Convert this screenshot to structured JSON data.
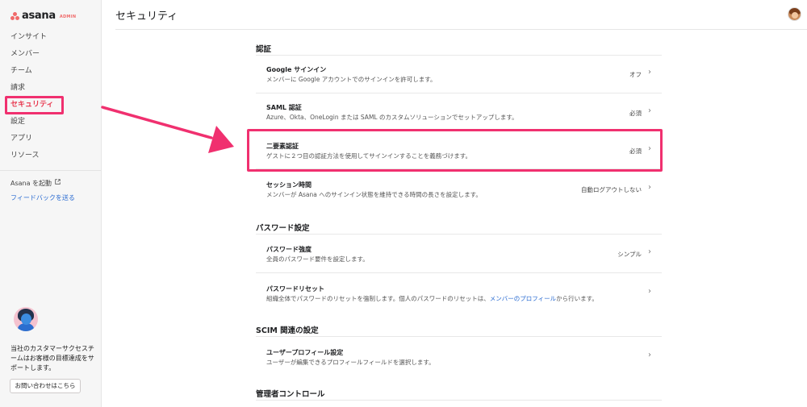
{
  "app": {
    "logo_word": "asana",
    "logo_badge": "ADMIN",
    "page_title": "セキュリティ"
  },
  "sidebar": {
    "items": [
      {
        "label": "インサイト",
        "active": false
      },
      {
        "label": "メンバー",
        "active": false
      },
      {
        "label": "チーム",
        "active": false
      },
      {
        "label": "請求",
        "active": false
      },
      {
        "label": "セキュリティ",
        "active": true
      },
      {
        "label": "設定",
        "active": false
      },
      {
        "label": "アプリ",
        "active": false
      },
      {
        "label": "リソース",
        "active": false
      }
    ],
    "launch_label": "Asana を起動",
    "feedback_label": "フィードバックを送る",
    "support_text": "当社のカスタマーサクセスチームはお客様の目標達成をサポートします。",
    "contact_button": "お問い合わせはこちら"
  },
  "sections": {
    "auth": {
      "title": "認証",
      "rows": [
        {
          "title": "Google サインイン",
          "desc": "メンバーに Google アカウントでのサインインを許可します。",
          "value": "オフ"
        },
        {
          "title": "SAML 認証",
          "desc": "Azure、Okta、OneLogin または SAML のカスタムソリューションでセットアップします。",
          "value": "必須"
        },
        {
          "title": "二要素認証",
          "desc": "ゲストに２つ目の認証方法を使用してサインインすることを義務づけます。",
          "value": "必須"
        },
        {
          "title": "セッション時間",
          "desc": "メンバーが Asana へのサインイン状態を維持できる時間の長さを設定します。",
          "value": "自動ログアウトしない"
        }
      ]
    },
    "password": {
      "title": "パスワード設定",
      "rows": [
        {
          "title": "パスワード強度",
          "desc": "全員のパスワード要件を設定します。",
          "value": "シンプル"
        },
        {
          "title": "パスワードリセット",
          "desc_before": "組織全体でパスワードのリセットを強制します。個人のパスワードのリセットは、",
          "desc_link": "メンバーのプロフィール",
          "desc_after": "から行います。",
          "value": ""
        }
      ]
    },
    "scim": {
      "title": "SCIM 関連の設定",
      "rows": [
        {
          "title": "ユーザープロフィール設定",
          "desc": "ユーザーが編集できるプロフィールフィールドを選択します。",
          "value": ""
        }
      ]
    },
    "admin": {
      "title": "管理者コントロール"
    }
  },
  "colors": {
    "accent": "#f06a6a",
    "highlight": "#f0306f",
    "active_nav": "#e8384f",
    "link": "#2a6bd1"
  }
}
